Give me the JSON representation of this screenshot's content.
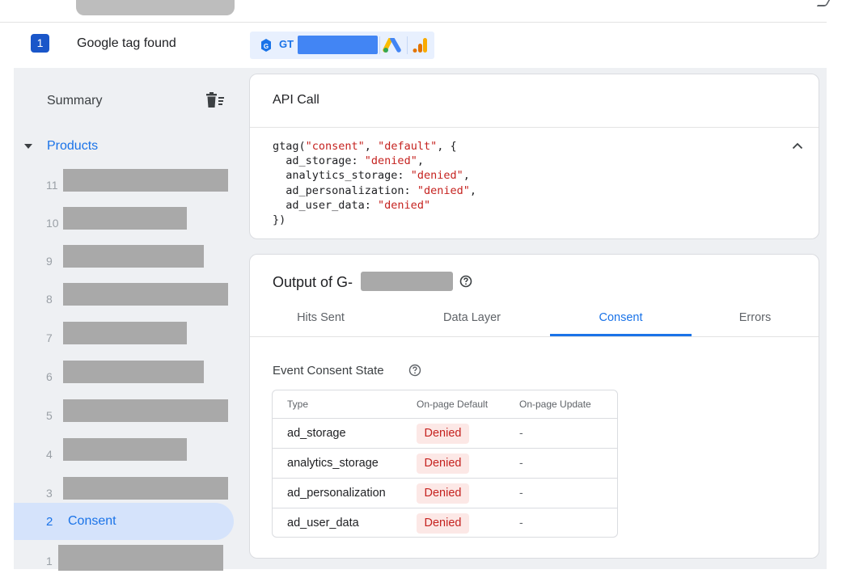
{
  "tag_row": {
    "index": "1",
    "label": "Google tag found",
    "chip_prefix": "GT"
  },
  "sidebar": {
    "summary_label": "Summary",
    "products_label": "Products",
    "items": [
      {
        "num": "11"
      },
      {
        "num": "10"
      },
      {
        "num": "9"
      },
      {
        "num": "8"
      },
      {
        "num": "7"
      },
      {
        "num": "6"
      },
      {
        "num": "5"
      },
      {
        "num": "4"
      },
      {
        "num": "3"
      },
      {
        "num": "2",
        "label": "Consent"
      },
      {
        "num": "1"
      }
    ]
  },
  "api_call": {
    "title": "API Call",
    "code_lines": [
      [
        "gtag(",
        "\"consent\"",
        ", ",
        "\"default\"",
        ", {"
      ],
      [
        "  ad_storage: ",
        "\"denied\"",
        ","
      ],
      [
        "  analytics_storage: ",
        "\"denied\"",
        ","
      ],
      [
        "  ad_personalization: ",
        "\"denied\"",
        ","
      ],
      [
        "  ad_user_data: ",
        "\"denied\""
      ],
      [
        "})"
      ]
    ]
  },
  "output": {
    "title_prefix": "Output of G-",
    "tabs": [
      {
        "label": "Hits Sent",
        "active": false
      },
      {
        "label": "Data Layer",
        "active": false
      },
      {
        "label": "Consent",
        "active": true
      },
      {
        "label": "Errors",
        "active": false
      }
    ],
    "section_label": "Event Consent State",
    "table": {
      "headers": [
        "Type",
        "On-page Default",
        "On-page Update"
      ],
      "rows": [
        {
          "type": "ad_storage",
          "default": "Denied",
          "update": "-"
        },
        {
          "type": "analytics_storage",
          "default": "Denied",
          "update": "-"
        },
        {
          "type": "ad_personalization",
          "default": "Denied",
          "update": "-"
        },
        {
          "type": "ad_user_data",
          "default": "Denied",
          "update": "-"
        }
      ]
    }
  },
  "colors": {
    "accent": "#1a73e8",
    "denied_text": "#c5221f",
    "denied_bg": "#fce8e6",
    "selected_nav_bg": "#d5e3fb"
  }
}
